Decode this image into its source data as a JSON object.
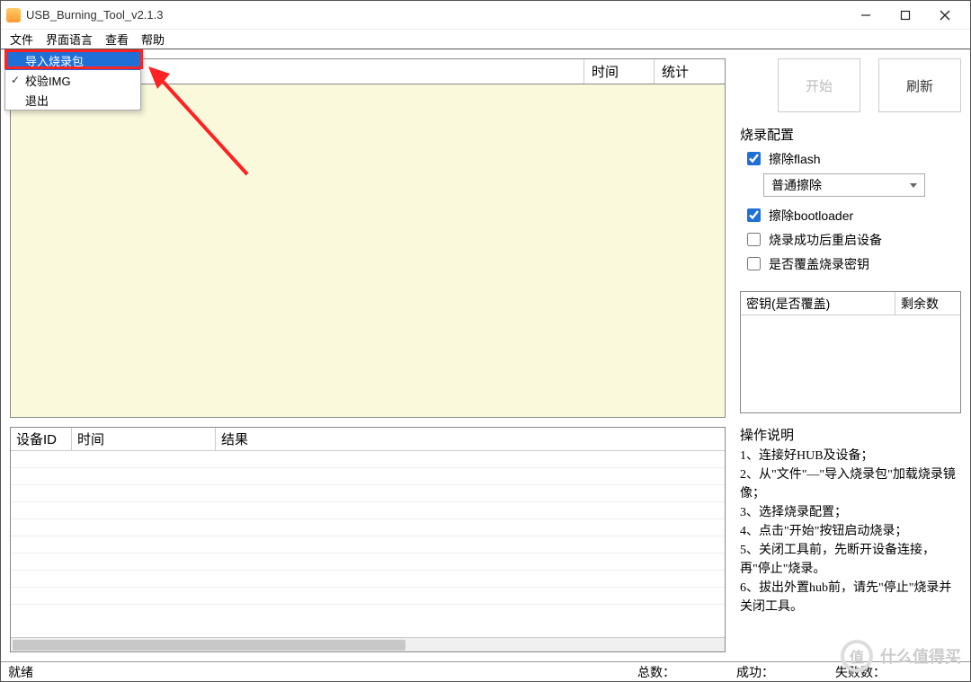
{
  "window": {
    "title": "USB_Burning_Tool_v2.1.3"
  },
  "menu": {
    "file": "文件",
    "lang": "界面语言",
    "view": "查看",
    "help": "帮助"
  },
  "file_menu": {
    "import": "导入烧录包",
    "verify": "校验IMG",
    "exit": "退出"
  },
  "top_table": {
    "col_time": "时间",
    "col_stat": "统计"
  },
  "device_table": {
    "col_id": "设备ID",
    "col_time": "时间",
    "col_result": "结果"
  },
  "buttons": {
    "start": "开始",
    "refresh": "刷新"
  },
  "config": {
    "title": "烧录配置",
    "erase_flash": "擦除flash",
    "erase_mode": "普通擦除",
    "erase_bootloader": "擦除bootloader",
    "reboot_after": "烧录成功后重启设备",
    "overwrite_key": "是否覆盖烧录密钥"
  },
  "keys_table": {
    "col_key": "密钥(是否覆盖)",
    "col_remain": "剩余数"
  },
  "instructions": {
    "title": "操作说明",
    "s1": "1、连接好HUB及设备；",
    "s2": "2、从\"文件\"—\"导入烧录包\"加载烧录镜像；",
    "s3": "3、选择烧录配置；",
    "s4": "4、点击\"开始\"按钮启动烧录；",
    "s5": "5、关闭工具前，先断开设备连接，再\"停止\"烧录。",
    "s6": "6、拔出外置hub前，请先\"停止\"烧录并关闭工具。"
  },
  "status": {
    "ready": "就绪",
    "total": "总数：",
    "success": "成功：",
    "fail": "失败数："
  },
  "watermark": {
    "char": "值",
    "text": "什么值得买"
  }
}
